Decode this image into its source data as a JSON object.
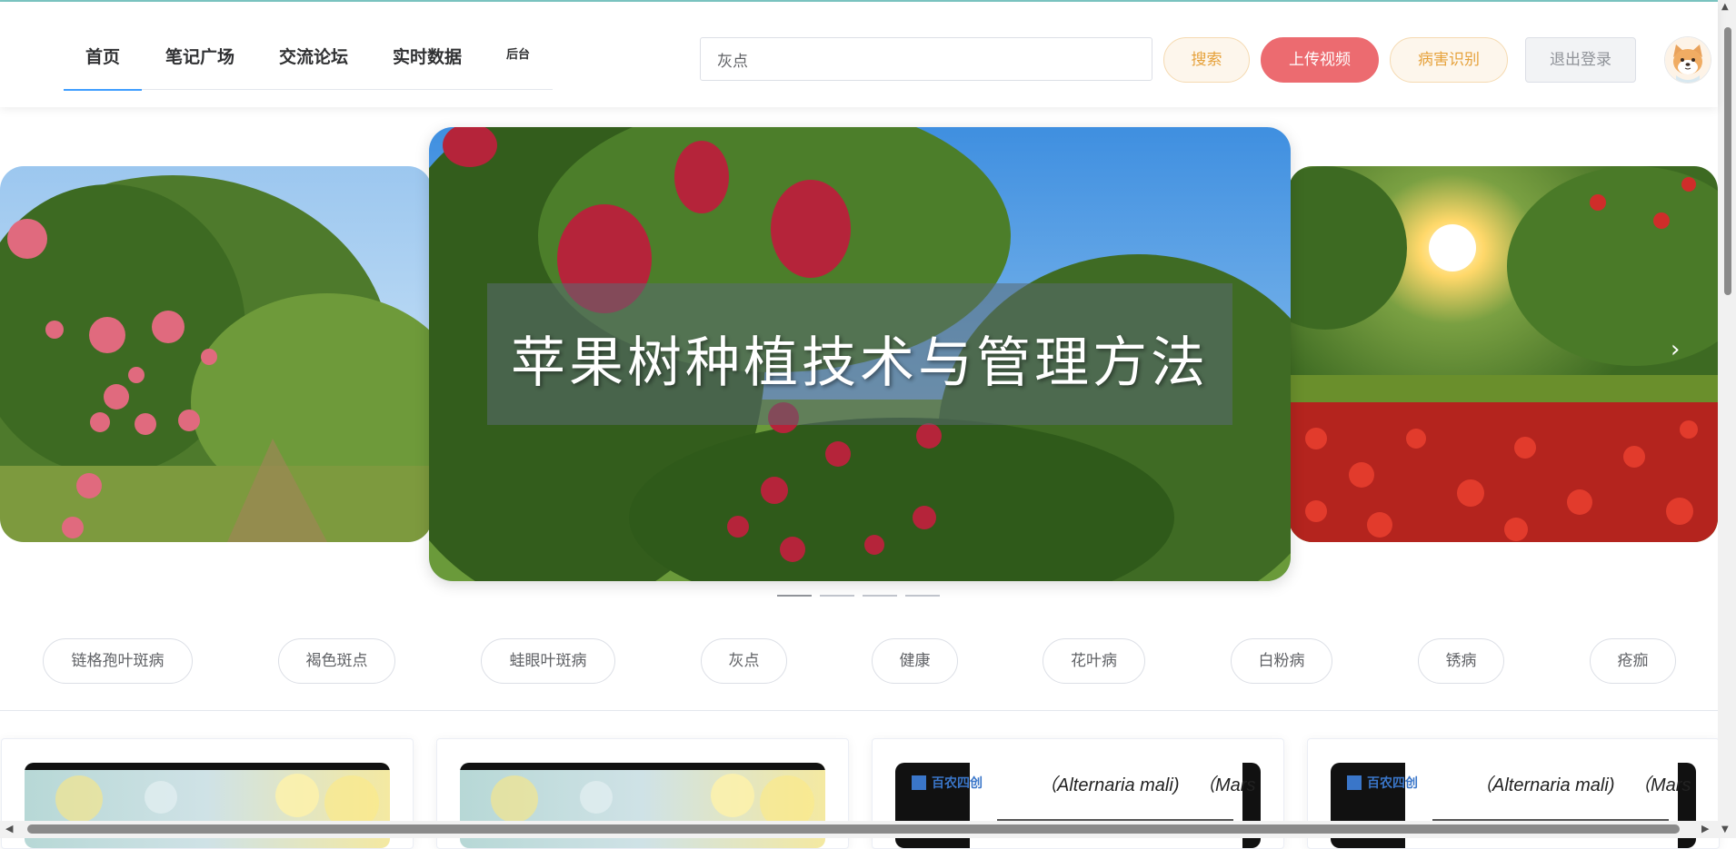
{
  "nav": {
    "items": [
      {
        "label": "首页",
        "active": true
      },
      {
        "label": "笔记广场"
      },
      {
        "label": "交流论坛"
      },
      {
        "label": "实时数据"
      },
      {
        "label": "后台"
      }
    ]
  },
  "search": {
    "value": "灰点"
  },
  "buttons": {
    "search": "搜索",
    "upload": "上传视频",
    "detect": "病害识别",
    "logout": "退出登录"
  },
  "carousel": {
    "center_caption": "苹果树种植技术与管理方法",
    "indicator_count": 4,
    "active_index": 0
  },
  "tags": [
    "链格孢叶斑病",
    "褐色斑点",
    "蛙眼叶斑病",
    "灰点",
    "健康",
    "花叶病",
    "白粉病",
    "锈病",
    "疮痂"
  ],
  "cards": [
    {
      "type": "light"
    },
    {
      "type": "light"
    },
    {
      "type": "video",
      "logo": "百农四创",
      "text1": "（Alternaria mali)",
      "text2": "（Mars"
    },
    {
      "type": "video",
      "logo": "百农四创",
      "text1": "（Alternaria mali)",
      "text2": "（Mars"
    }
  ],
  "colors": {
    "accent": "#409eff",
    "upload": "#ec6b70",
    "warning": "#e6a23c",
    "warning_bg": "#fdf6ec"
  },
  "icons": {
    "avatar": "shiba-dog-avatar-icon",
    "carousel_next": "chevron-right-icon",
    "scroll_up": "triangle-up-icon",
    "scroll_down": "triangle-down-icon",
    "scroll_left": "triangle-left-icon",
    "scroll_right": "triangle-right-icon"
  }
}
